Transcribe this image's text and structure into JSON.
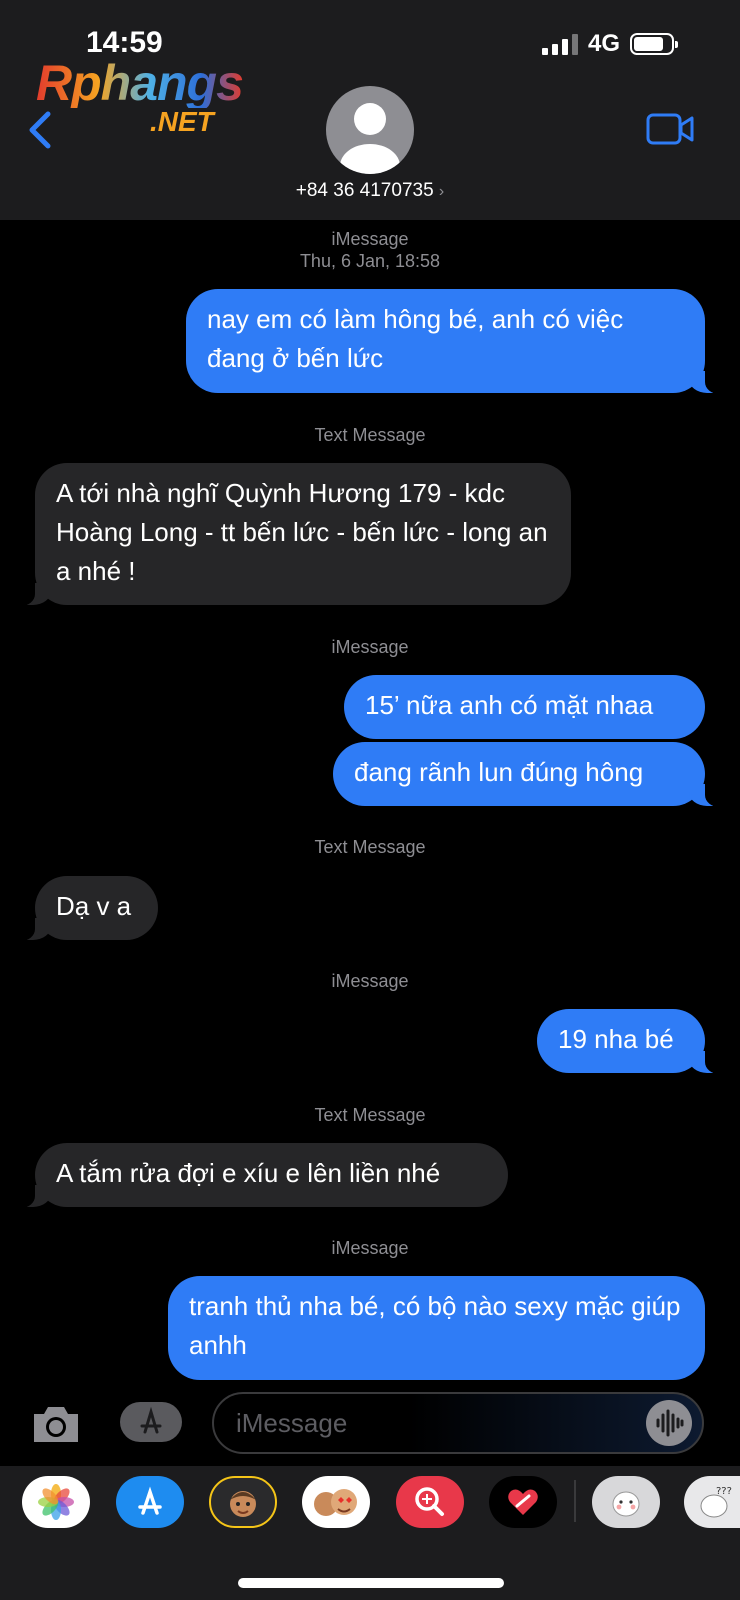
{
  "status": {
    "time": "14:59",
    "network": "4G"
  },
  "watermark": {
    "main": "Rphangs",
    "sub": ".NET"
  },
  "contact": {
    "phone": "+84 36 4170735",
    "chevron": "›"
  },
  "labels": {
    "l1": "iMessage",
    "l1_date": "Thu, 6 Jan, 18:58",
    "l2": "Text Message",
    "l3": "iMessage",
    "l4": "Text Message",
    "l5": "iMessage",
    "l6": "Text Message",
    "l7": "iMessage"
  },
  "messages": [
    {
      "from": "me",
      "text": "nay em có làm hông bé, anh có việc đang ở bến lức"
    },
    {
      "from": "them",
      "text": "A tới nhà nghĩ Quỳnh Hương 179 - kdc Hoàng Long - tt bến lức - bến lức - long an a nhé !"
    },
    {
      "from": "me",
      "text": "15’ nữa anh có mặt nhaa"
    },
    {
      "from": "me",
      "text": "đang rãnh lun đúng hông"
    },
    {
      "from": "them",
      "text": "Dạ v a"
    },
    {
      "from": "me",
      "text": "19 nha bé"
    },
    {
      "from": "them",
      "text": "A tắm rửa đợi e xíu e lên liền nhé"
    },
    {
      "from": "me",
      "text": "tranh thủ nha bé, có bộ nào sexy mặc giúp anhh"
    }
  ],
  "input": {
    "placeholder": "iMessage"
  },
  "colors": {
    "outgoing": "#2f7cf6",
    "incoming": "#262628",
    "header": "#1c1c1e",
    "accent": "#2f7cf6"
  },
  "apps": [
    "photos-icon",
    "app-store-icon",
    "memoji-icon",
    "memoji-stickers-icon",
    "image-search-icon",
    "digital-touch-icon",
    "sticker-icon",
    "sticker-icon"
  ]
}
